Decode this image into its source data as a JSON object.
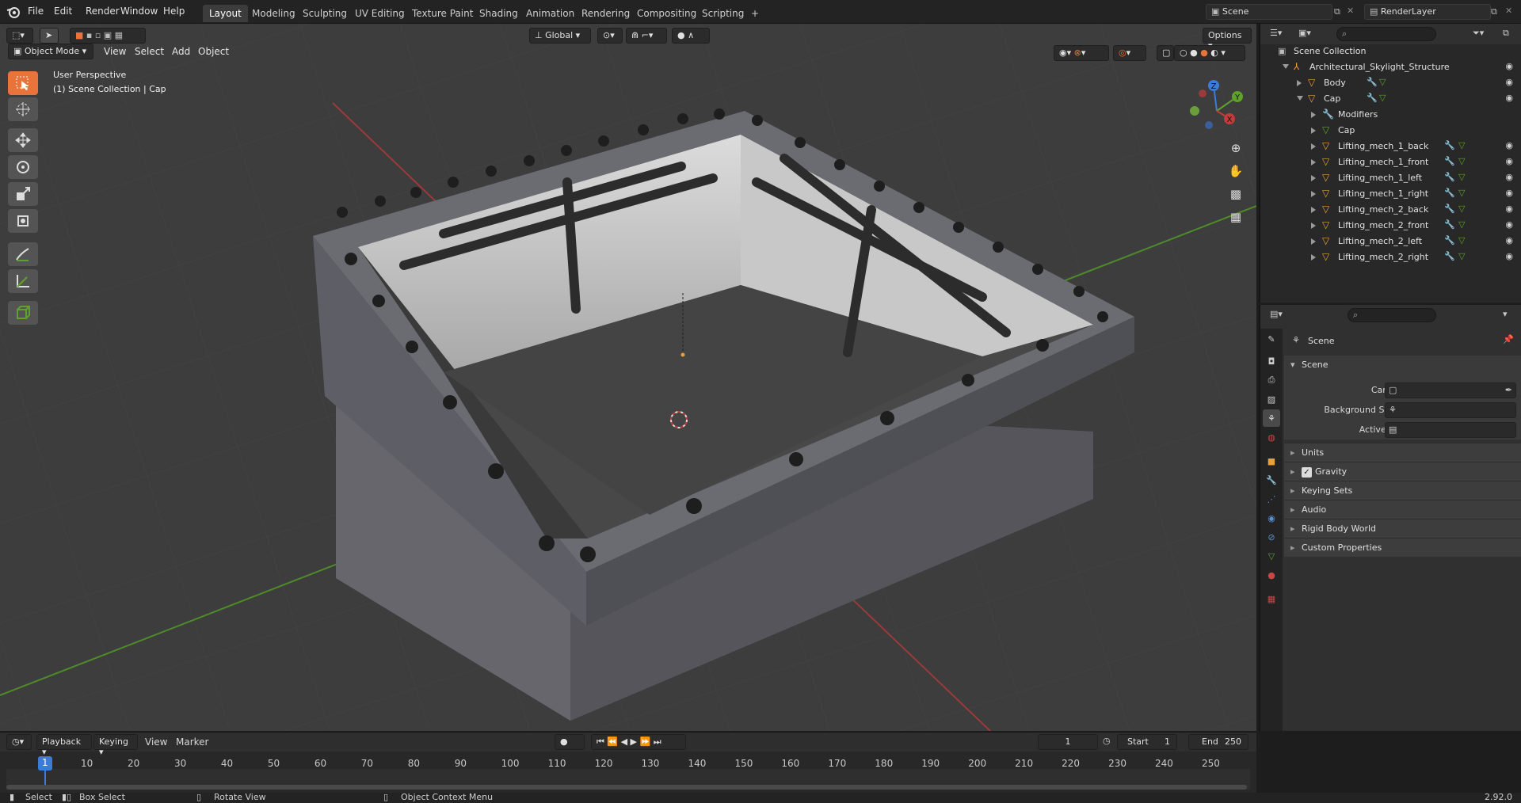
{
  "topbar": {
    "menus": [
      "File",
      "Edit",
      "Render",
      "Window",
      "Help"
    ],
    "workspaces": [
      "Layout",
      "Modeling",
      "Sculpting",
      "UV Editing",
      "Texture Paint",
      "Shading",
      "Animation",
      "Rendering",
      "Compositing",
      "Scripting"
    ],
    "active_workspace": "Layout",
    "add_tab": "+",
    "scene_name": "Scene",
    "view_layer": "RenderLayer"
  },
  "viewport": {
    "mode": "Object Mode",
    "menus": [
      "View",
      "Select",
      "Add",
      "Object"
    ],
    "orientation": "Global",
    "options_label": "Options",
    "info_line1": "User Perspective",
    "info_line2": "(1) Scene Collection | Cap",
    "gizmo_axes": [
      "Z",
      "Y",
      "X"
    ]
  },
  "outliner": {
    "root": "Scene Collection",
    "items": [
      {
        "label": "Architectural_Skylight_Structure",
        "type": "armature"
      },
      {
        "label": "Body",
        "type": "mesh"
      },
      {
        "label": "Cap",
        "type": "mesh"
      },
      {
        "label": "Modifiers",
        "type": "modifier"
      },
      {
        "label": "Cap",
        "type": "meshdata"
      },
      {
        "label": "Lifting_mech_1_back",
        "type": "mesh"
      },
      {
        "label": "Lifting_mech_1_front",
        "type": "mesh"
      },
      {
        "label": "Lifting_mech_1_left",
        "type": "mesh"
      },
      {
        "label": "Lifting_mech_1_right",
        "type": "mesh"
      },
      {
        "label": "Lifting_mech_2_back",
        "type": "mesh"
      },
      {
        "label": "Lifting_mech_2_front",
        "type": "mesh"
      },
      {
        "label": "Lifting_mech_2_left",
        "type": "mesh"
      },
      {
        "label": "Lifting_mech_2_right",
        "type": "mesh"
      }
    ]
  },
  "properties": {
    "context_title": "Scene",
    "panel": "Scene",
    "fields": [
      {
        "label": "Camera",
        "value": ""
      },
      {
        "label": "Background Scene",
        "value": ""
      },
      {
        "label": "Active Clip",
        "value": ""
      }
    ],
    "subpanels": [
      "Units",
      "Gravity",
      "Keying Sets",
      "Audio",
      "Rigid Body World",
      "Custom Properties"
    ],
    "gravity_checked": true
  },
  "timeline": {
    "menus": [
      "Playback",
      "Keying",
      "View",
      "Marker"
    ],
    "current_frame": "1",
    "start_label": "Start",
    "start_value": "1",
    "end_label": "End",
    "end_value": "250",
    "ticks": [
      "1",
      "10",
      "20",
      "30",
      "40",
      "50",
      "60",
      "70",
      "80",
      "90",
      "100",
      "110",
      "120",
      "130",
      "140",
      "150",
      "160",
      "170",
      "180",
      "190",
      "200",
      "210",
      "220",
      "230",
      "240",
      "250"
    ]
  },
  "statusbar": {
    "select": "Select",
    "box_select": "Box Select",
    "rotate_view": "Rotate View",
    "context_menu": "Object Context Menu",
    "version": "2.92.0"
  },
  "colors": {
    "accent": "#e8743b",
    "axis_x": "#c43b3b",
    "axis_y": "#5fa12c",
    "axis_z": "#3d7bd9",
    "mesh_icon": "#e8a03c"
  }
}
